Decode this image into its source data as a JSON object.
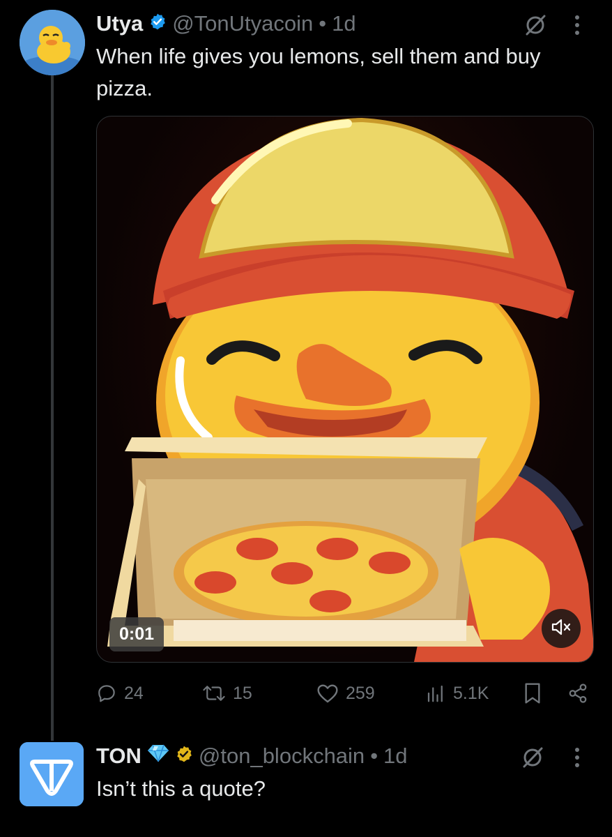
{
  "tweet1": {
    "name": "Utya",
    "handle": "@TonUtyacoin",
    "separator": "•",
    "time": "1d",
    "text": "When life gives you lemons, sell them and buy pizza.",
    "video_time": "0:01",
    "replies": "24",
    "retweets": "15",
    "likes": "259",
    "views": "5.1K"
  },
  "tweet2": {
    "name": "TON",
    "handle": "@ton_blockchain",
    "separator": "•",
    "time": "1d",
    "text": "Isn’t this a quote?"
  },
  "colors": {
    "background": "#000000",
    "text_primary": "#e7e9ea",
    "text_secondary": "#71767b",
    "verified_blue": "#1d9bf0",
    "verified_gold": "#e2b719",
    "ton_blue": "#5aa8f5"
  },
  "icons": [
    "verified-badge-icon",
    "grok-icon",
    "more-icon",
    "reply-icon",
    "retweet-icon",
    "like-icon",
    "views-icon",
    "bookmark-icon",
    "share-icon",
    "mute-icon",
    "diamond-icon",
    "ton-logo-icon"
  ]
}
